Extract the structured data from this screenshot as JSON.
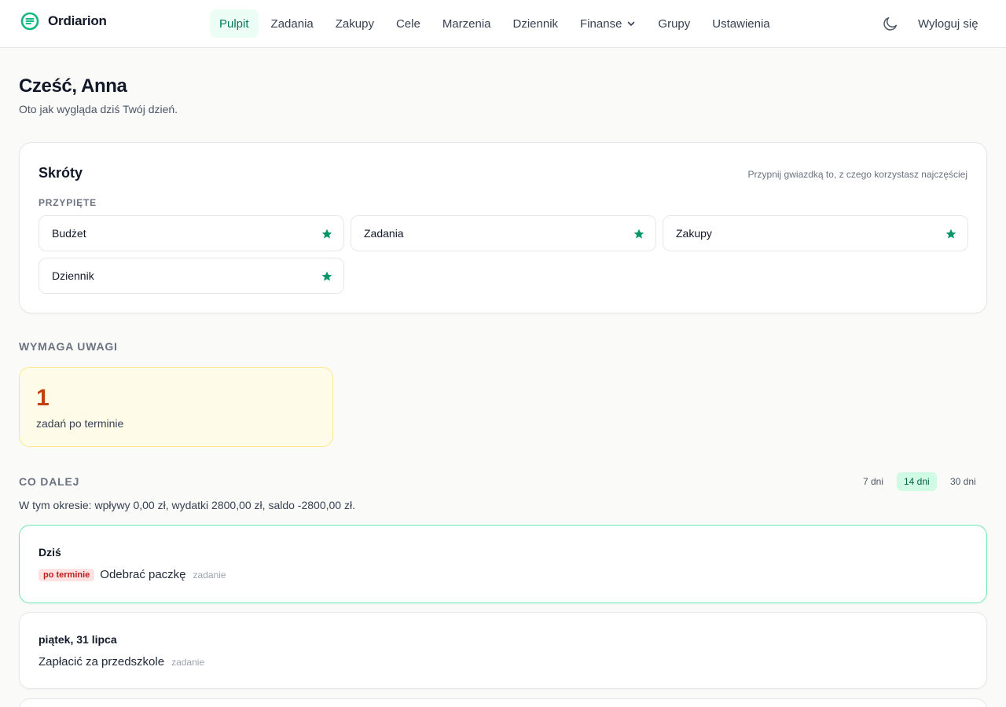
{
  "app": {
    "name": "Ordiarion"
  },
  "nav": {
    "items": [
      "Pulpit",
      "Zadania",
      "Zakupy",
      "Cele",
      "Marzenia",
      "Dziennik",
      "Finanse",
      "Grupy",
      "Ustawienia"
    ],
    "active": "Pulpit"
  },
  "header": {
    "theme_icon": "moon-icon",
    "logout_label": "Wyloguj się"
  },
  "greeting": {
    "title": "Cześć, Anna",
    "subtitle": "Oto jak wygląda dziś Twój dzień."
  },
  "shortcuts": {
    "title": "Skróty",
    "hint": "Przypnij gwiazdką to, z czego korzystasz najczęściej",
    "pinned_label": "PRZYPIĘTE",
    "items": [
      "Budżet",
      "Zadania",
      "Zakupy",
      "Dziennik"
    ],
    "star_color": "#059669"
  },
  "attention": {
    "title": "WYMAGA UWAGI",
    "count": "1",
    "label": "zadań po terminie"
  },
  "next": {
    "title": "CO DALEJ",
    "ranges": [
      "7 dni",
      "14 dni",
      "30 dni"
    ],
    "active_range": "14 dni",
    "summary": "W tym okresie: wpływy 0,00 zł, wydatki 2800,00 zł, saldo -2800,00 zł.",
    "days": [
      {
        "title": "Dziś",
        "badge": "po terminie",
        "item": "Odebrać paczkę",
        "kind": "zadanie"
      },
      {
        "title": "piątek, 31 lipca",
        "item": "Zapłacić za przedszkole",
        "kind": "zadanie"
      }
    ]
  },
  "colors": {
    "accent": "#059669",
    "accent_bg": "#ecfdf5",
    "warning_bg": "#fefce8",
    "overdue": "#b91c1c"
  }
}
